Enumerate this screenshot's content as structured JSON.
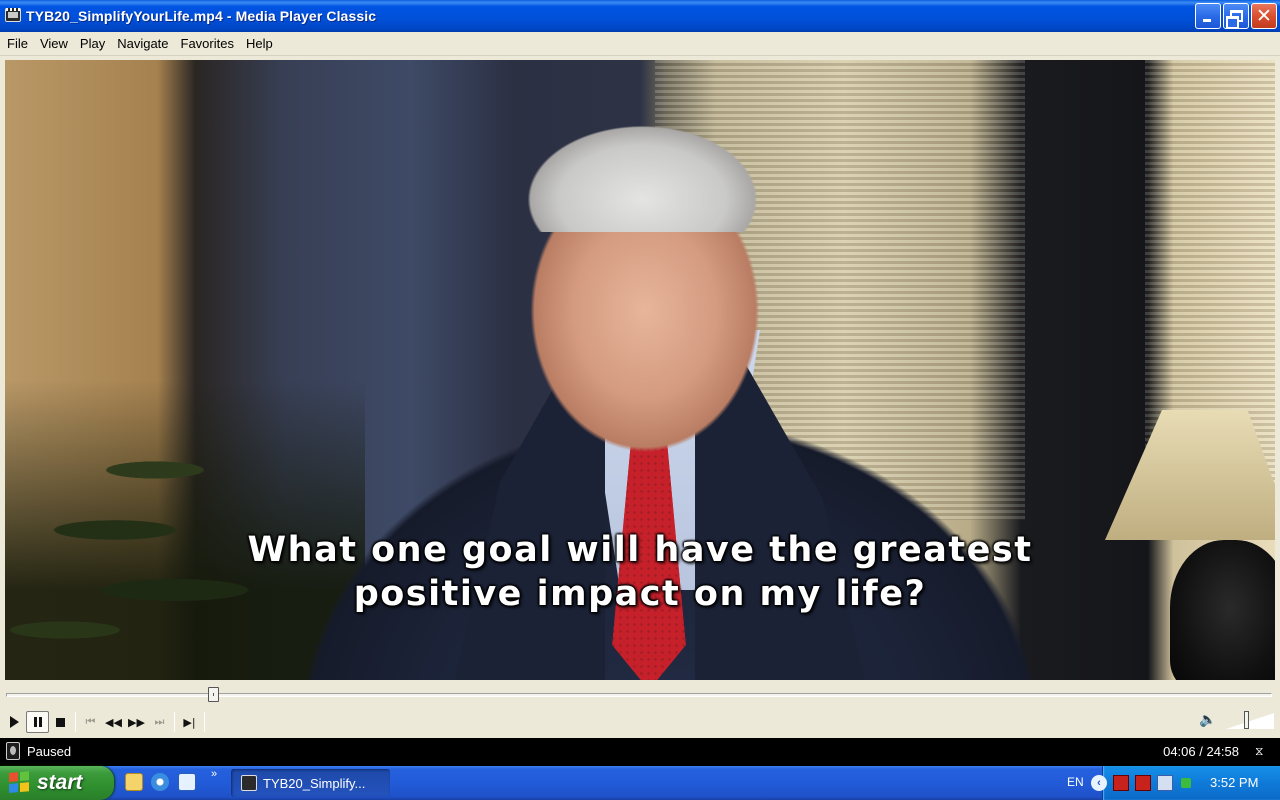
{
  "window": {
    "title": "TYB20_SimplifyYourLife.mp4 - Media Player Classic",
    "close_glyph": "✕"
  },
  "menu": {
    "items": [
      "File",
      "View",
      "Play",
      "Navigate",
      "Favorites",
      "Help"
    ]
  },
  "video": {
    "subtitle_line1": "What one goal will have the greatest",
    "subtitle_line2": "positive impact on my life?"
  },
  "seek": {
    "position_fraction": 0.164
  },
  "controls": {
    "icons": [
      "play-icon",
      "pause-icon",
      "stop-icon",
      "skip-back-icon",
      "rewind-icon",
      "fast-forward-icon",
      "skip-forward-icon",
      "frame-step-icon"
    ],
    "volume_fraction": 0.4
  },
  "status": {
    "state": "Paused",
    "time": "04:06 / 24:58"
  },
  "taskbar": {
    "start_label": "start",
    "quick_launch_more": "»",
    "task_label": "TYB20_Simplify...",
    "language": "EN",
    "tray_arrow": "‹",
    "clock": "3:52 PM"
  },
  "colors": {
    "titlebar": "#0054e3",
    "menubar": "#ece9d8",
    "taskbar": "#245edb",
    "start_button": "#3c9c3c",
    "tie": "#c22029"
  }
}
